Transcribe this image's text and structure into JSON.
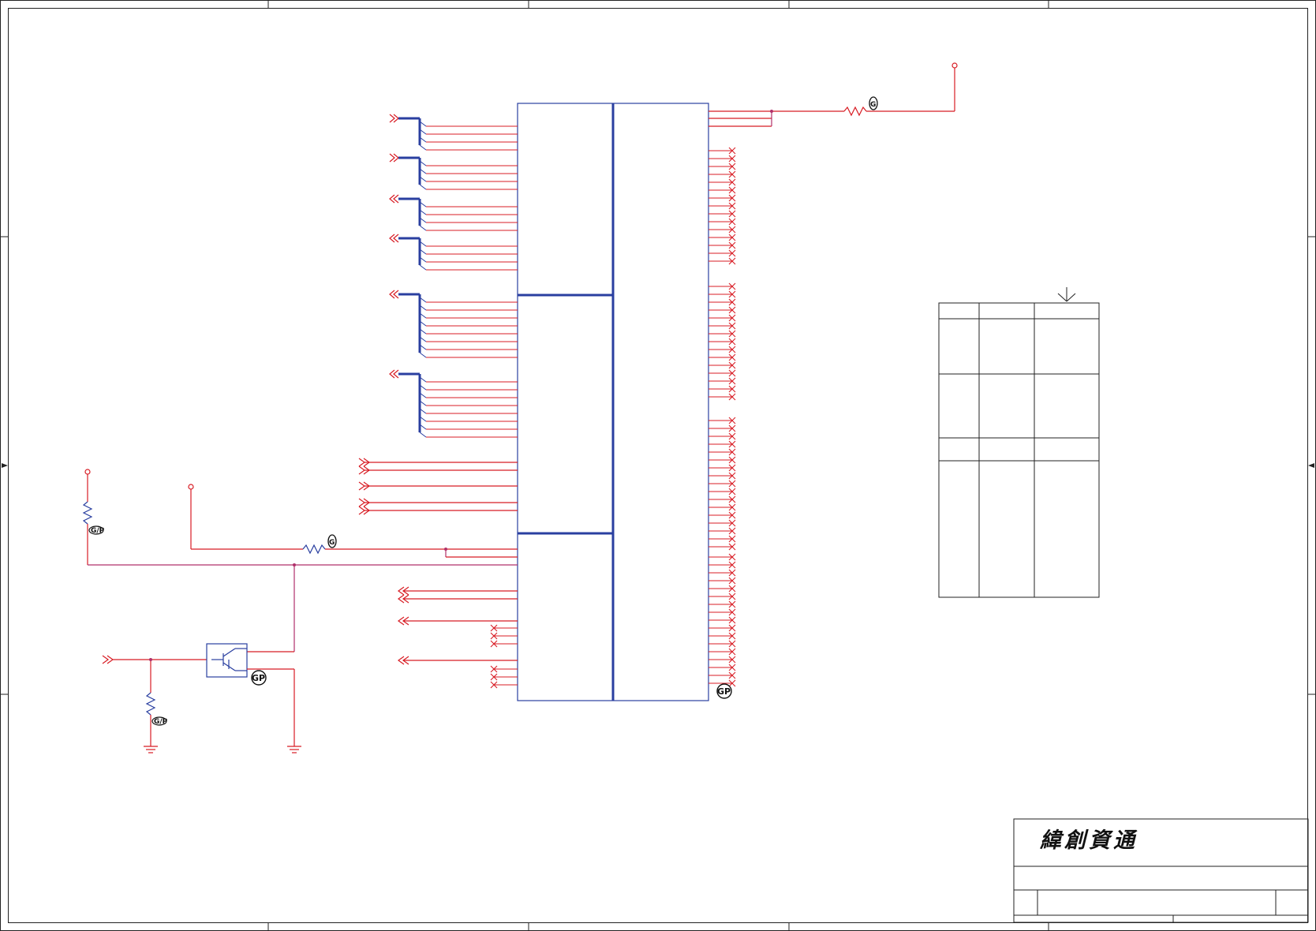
{
  "title_block": {
    "company_name": "緯創資通"
  },
  "markers": {
    "gp_label": "GP",
    "res_label_a": "G",
    "res_label_b": "G/P"
  },
  "colors": {
    "border": "#222222",
    "wire_red": "#d81c24",
    "bus_blue": "#2a3fa0",
    "symbol_blue": "#2a3fa0",
    "junction": "#b0306a"
  },
  "pin_groups": {
    "bus_groups": [
      {
        "id": "bus-1",
        "direction": "in",
        "pins": 4
      },
      {
        "id": "bus-2",
        "direction": "in",
        "pins": 4
      },
      {
        "id": "bus-3",
        "direction": "out",
        "pins": 4
      },
      {
        "id": "bus-4",
        "direction": "out",
        "pins": 4
      },
      {
        "id": "bus-5",
        "direction": "out",
        "pins": 8
      },
      {
        "id": "bus-6",
        "direction": "out",
        "pins": 8
      }
    ],
    "right_nc_pins": 68
  }
}
